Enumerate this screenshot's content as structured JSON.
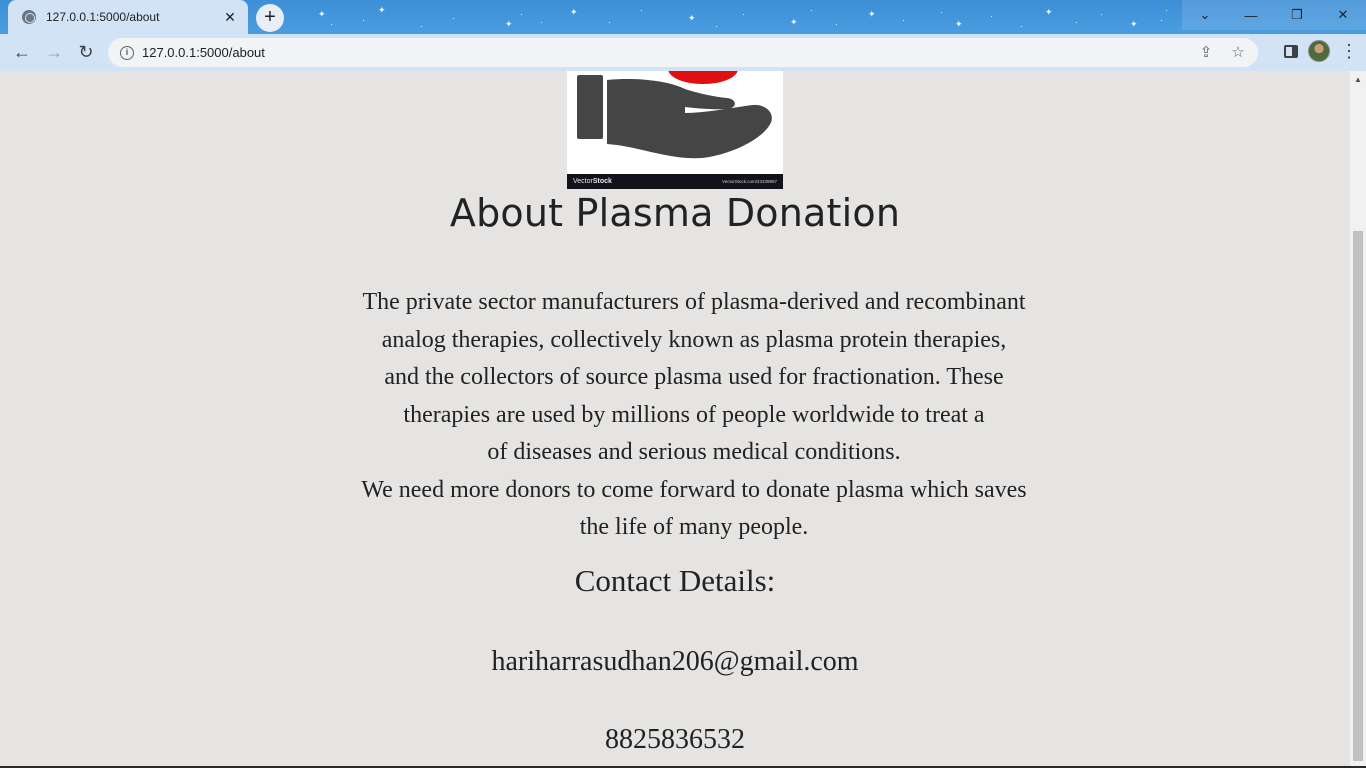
{
  "browser": {
    "tab_title": "127.0.0.1:5000/about",
    "tab_close": "✕",
    "new_tab": "+",
    "url": "127.0.0.1:5000/about",
    "window_controls": {
      "tabsearch": "⌄",
      "minimize": "—",
      "restore": "❐",
      "close": "✕"
    },
    "nav": {
      "back": "←",
      "forward": "→",
      "reload": "↻"
    },
    "omnibox_icons": {
      "share": "⇪",
      "bookmark": "☆"
    },
    "menu": "⋮"
  },
  "page": {
    "image": {
      "brand_prefix": "Vector",
      "brand_bold": "Stock",
      "reference": "VectorStock.com/23339957"
    },
    "heading": "About Plasma Donation",
    "paragraph_lines": [
      "The private sector manufacturers of plasma-derived and recombinant",
      "analog therapies, collectively known as plasma protein therapies,",
      "and the collectors of source plasma used for fractionation. These",
      "therapies are used by millions of people worldwide to treat a",
      "of diseases and serious medical conditions.",
      "We need more donors to come forward to donate plasma which saves",
      "the life of many people."
    ],
    "contact_heading": "Contact Details:",
    "email": "hariharrasudhan206@gmail.com",
    "phone": "8825836532"
  },
  "colors": {
    "titlebar": "#4a9de0",
    "toolbar": "#d3e3f6",
    "page_background": "#e5e4e3",
    "text": "#222222",
    "blood_red": "#e01010",
    "hand_gray": "#454545"
  }
}
